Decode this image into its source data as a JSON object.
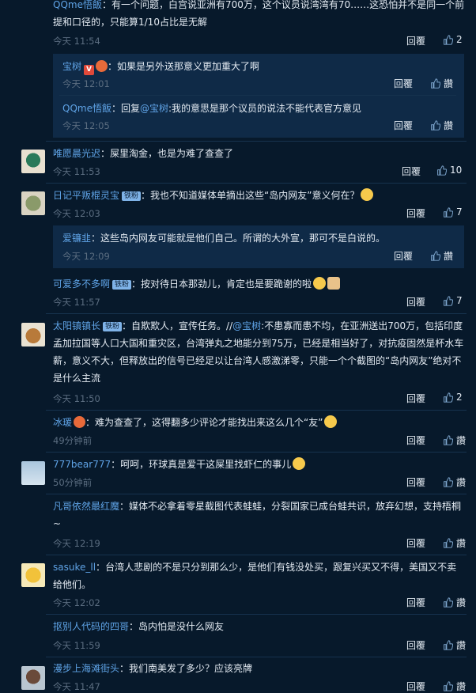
{
  "reply_label": "回覆",
  "like_zero": "讚",
  "comments": [
    {
      "user": "QQme悟飯",
      "text": "有一个问题，白宫说亚洲有700万，这个议员说湾湾有70……这恐怕并不是同一个前提和口径的，只能算1/10占比是无解",
      "time": "今天 11:54",
      "likes": "2"
    },
    {
      "user": "宝树",
      "text": "如果是另外送那意义更加重大了啊",
      "time": "今天 12:01",
      "likes": "讚"
    },
    {
      "user": "QQme悟飯",
      "text_pre": "回复",
      "mention": "@宝树",
      "text": ":我的意思是那个议员的说法不能代表官方意见",
      "time": "今天 12:05",
      "likes": "讚"
    },
    {
      "user": "唯愿晨光迟",
      "text": "屎里淘金，也是为难了查查了",
      "time": "今天 11:53",
      "likes": "10"
    },
    {
      "user": "日记平叛棍灵宝",
      "badge": "铁粉",
      "text": "我也不知道媒体单摘出这些“岛内网友”意义何在？",
      "time": "今天 12:03",
      "likes": "7"
    },
    {
      "user": "爱镰韭",
      "text": "这些岛内网友可能就是他们自己。所谓的大外宣，那可不是白说的。",
      "time": "今天 12:09",
      "likes": "讚"
    },
    {
      "user": "可爱多不多啊",
      "badge": "铁粉",
      "text": "按对待日本那劲儿，肯定也是要跪谢的啦",
      "time": "今天 11:57",
      "likes": "7"
    },
    {
      "user": "太阳镇镇长",
      "badge": "铁粉",
      "text": "自欺欺人，宣传任务。//",
      "mention": "@宝树",
      "text2": ":不患寡而患不均，在亚洲送出700万，包括印度孟加拉国等人口大国和重灾区，台湾弹丸之地能分到75万，已经是相当好了，对抗疫固然是杯水车薪，意义不大，但释放出的信号已经足以让台湾人感激涕零，只能一个个截图的“岛内网友”绝对不是什么主流",
      "time": "今天 11:50",
      "likes": "2"
    },
    {
      "user": "冰瑗",
      "text": "难为查查了，这得翻多少评论才能找出来这么几个“友”",
      "time": "49分钟前",
      "likes": "讚"
    },
    {
      "user": "777bear777",
      "text": "呵呵，环球真是爱干这屎里找虾仁的事儿",
      "time": "50分钟前",
      "likes": "讚"
    },
    {
      "user": "凡哥依然最红魔",
      "text": "媒体不必拿着零星截图代表蛙蛙，分裂国家已成台蛙共识，放弃幻想，支持梧桐~",
      "time": "今天 12:19",
      "likes": "讚"
    },
    {
      "user": "sasuke_ll",
      "text": "台湾人悲剧的不是只分到那么少，是他们有钱没处买，跟复兴买又不得，美国又不卖给他们。",
      "time": "今天 12:02",
      "likes": "讚"
    },
    {
      "user": "抠别人代码的四哥",
      "text": "岛内怕是没什么网友",
      "time": "今天 11:59",
      "likes": "讚"
    },
    {
      "user": "漫步上海滩街头",
      "text": "我们南美发了多少？应该亮牌",
      "time": "今天 11:47",
      "likes": "讚"
    }
  ]
}
